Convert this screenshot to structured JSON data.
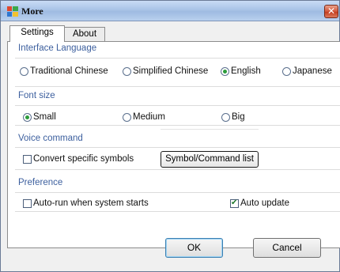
{
  "window": {
    "title": "More",
    "close_glyph": "✕"
  },
  "tabs": [
    {
      "label": "Settings",
      "selected": true
    },
    {
      "label": "About",
      "selected": false
    }
  ],
  "sections": {
    "interface_language": {
      "title": "Interface Language",
      "options": [
        {
          "label": "Traditional Chinese",
          "selected": false
        },
        {
          "label": "Simplified Chinese",
          "selected": false
        },
        {
          "label": "English",
          "selected": true
        },
        {
          "label": "Japanese",
          "selected": false
        }
      ]
    },
    "font_size": {
      "title": "Font size",
      "options": [
        {
          "label": "Small",
          "selected": true
        },
        {
          "label": "Medium",
          "selected": false
        },
        {
          "label": "Big",
          "selected": false
        }
      ]
    },
    "voice_command": {
      "title": "Voice command",
      "convert_label": "Convert specific symbols",
      "convert_checked": false,
      "symbol_list_button": "Symbol/Command list"
    },
    "preference": {
      "title": "Preference",
      "autorun_label": "Auto-run when system starts",
      "autorun_checked": false,
      "autoupdate_label": "Auto update",
      "autoupdate_checked": true
    }
  },
  "buttons": {
    "ok": "OK",
    "cancel": "Cancel"
  },
  "colors": {
    "section_title": "#3c5f9e",
    "radio_selected": "#2b9c3b",
    "close_button": "#c33e20",
    "title_bar": "#a9c3e7"
  },
  "icons": {
    "app": "app-logo-icon",
    "close": "close-icon"
  }
}
